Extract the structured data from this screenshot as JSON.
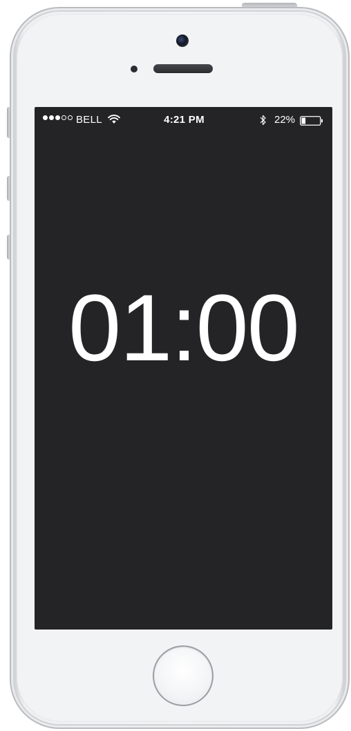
{
  "status_bar": {
    "signal_bars_filled": 3,
    "signal_bars_total": 5,
    "carrier": "BELL",
    "wifi_icon": "wifi-icon",
    "time": "4:21 PM",
    "bluetooth_icon": "bluetooth-icon",
    "battery_percent_label": "22%",
    "battery_level": 0.22
  },
  "timer": {
    "display": "01:00"
  },
  "colors": {
    "screen_background": "#242426",
    "text": "#ffffff",
    "device_body": "#f2f3f5"
  }
}
